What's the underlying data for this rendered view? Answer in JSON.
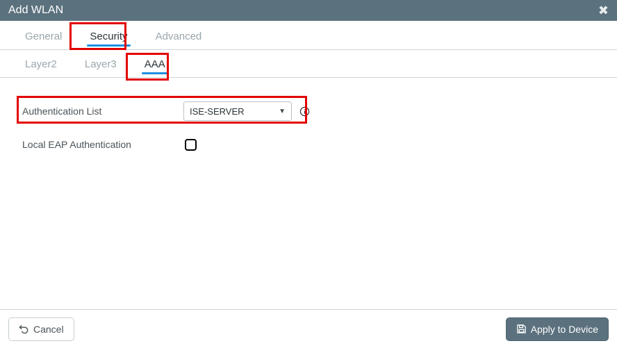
{
  "window": {
    "title": "Add WLAN"
  },
  "tabs": {
    "items": [
      {
        "label": "General"
      },
      {
        "label": "Security"
      },
      {
        "label": "Advanced"
      }
    ],
    "active_index": 1
  },
  "subtabs": {
    "items": [
      {
        "label": "Layer2"
      },
      {
        "label": "Layer3"
      },
      {
        "label": "AAA"
      }
    ],
    "active_index": 2
  },
  "form": {
    "auth_list": {
      "label": "Authentication List",
      "value": "ISE-SERVER"
    },
    "local_eap": {
      "label": "Local EAP Authentication",
      "checked": false
    }
  },
  "footer": {
    "cancel_label": "Cancel",
    "apply_label": "Apply to Device"
  }
}
